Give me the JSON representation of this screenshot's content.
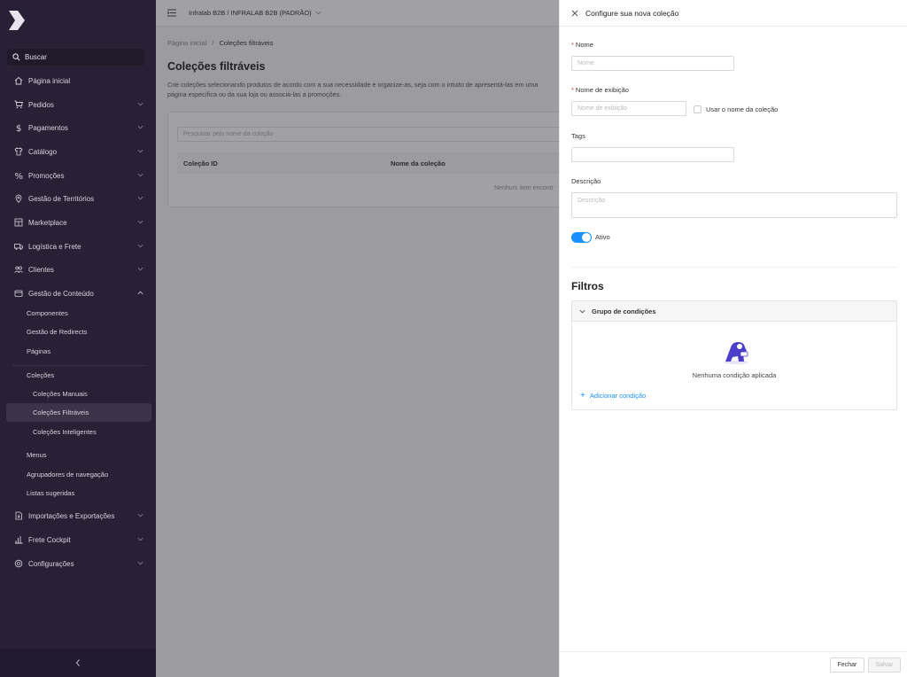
{
  "sidebar": {
    "search_label": "Buscar",
    "items": [
      {
        "label": "Página inicial",
        "icon": "home-icon"
      },
      {
        "label": "Pedidos",
        "icon": "cart-icon"
      },
      {
        "label": "Pagamentos",
        "icon": "dollar-icon"
      },
      {
        "label": "Catálogo",
        "icon": "shirt-icon"
      },
      {
        "label": "Promoções",
        "icon": "percent-icon"
      },
      {
        "label": "Gestão de Territórios",
        "icon": "map-pin-icon"
      },
      {
        "label": "Marketplace",
        "icon": "store-icon"
      },
      {
        "label": "Logística e Frete",
        "icon": "truck-icon"
      },
      {
        "label": "Clientes",
        "icon": "users-icon"
      },
      {
        "label": "Gestão de Conteúdo",
        "icon": "content-icon"
      }
    ],
    "content_sub": [
      "Componentes",
      "Gestão de Redirects",
      "Páginas"
    ],
    "collections_label": "Coleções",
    "collections_sub": [
      "Coleções Manuais",
      "Coleções Filtráveis",
      "Coleções Inteligentes"
    ],
    "content_sub2": [
      "Menus",
      "Agrupadores de navegação",
      "Listas sugeridas"
    ],
    "bottom_items": [
      {
        "label": "Importações e Exportações",
        "icon": "import-icon"
      },
      {
        "label": "Frete Cockpit",
        "icon": "chart-icon"
      },
      {
        "label": "Configurações",
        "icon": "settings-icon"
      }
    ]
  },
  "topbar": {
    "account": "Infralab B2B / INFRALAB B2B (PADRÃO)"
  },
  "breadcrumb": {
    "home": "Página inicial",
    "separator": "/",
    "current": "Coleções filtráveis"
  },
  "page": {
    "title": "Coleções filtráveis",
    "description": "Crie coleções selecionando produtos de acordo com a sua necessidade e organize-as, seja com o intuito de apresentá-las em uma página específica ou da sua loja ou associá-las a promoções.",
    "search_placeholder": "Pesquisar pelo nome da coleção",
    "columns": [
      "Coleção ID",
      "Nome da coleção"
    ],
    "empty_text": "Nenhum item encontr"
  },
  "drawer": {
    "title": "Configure sua nova coleção",
    "name_label": "Nome",
    "name_placeholder": "Nome",
    "display_label": "Nome de exibição",
    "display_placeholder": "Nome de exibição",
    "use_name_label": "Usar o nome da coleção",
    "tags_label": "Tags",
    "description_label": "Descrição",
    "description_placeholder": "Descrição",
    "active_label": "Ativo",
    "filters_title": "Filtros",
    "group_label": "Grupo de condições",
    "empty_conditions": "Nenhuma condição aplicada",
    "add_condition": "Adicionar condição",
    "close_button": "Fechar",
    "save_button": "Salvar"
  },
  "colors": {
    "sidebar_bg": "#2a2036",
    "accent": "#1890ff",
    "required": "#e4393c"
  }
}
